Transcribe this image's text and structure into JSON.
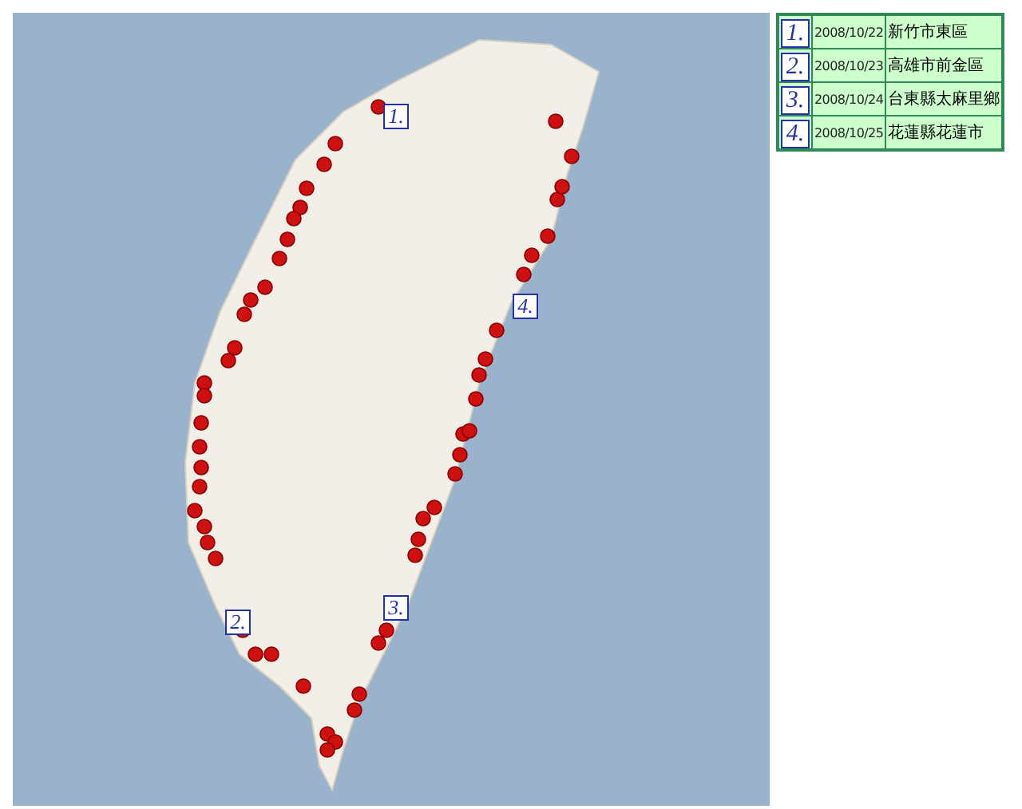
{
  "map": {
    "markers": [
      "1.",
      "2.",
      "3.",
      "4."
    ]
  },
  "legend": [
    {
      "marker": "1.",
      "date": "2008/10/22",
      "place": "新竹市東區"
    },
    {
      "marker": "2.",
      "date": "2008/10/23",
      "place": "高雄市前金區"
    },
    {
      "marker": "3.",
      "date": "2008/10/24",
      "place": "台東縣太麻里鄉"
    },
    {
      "marker": "4.",
      "date": "2008/10/25",
      "place": "花蓮縣花蓮市"
    }
  ]
}
